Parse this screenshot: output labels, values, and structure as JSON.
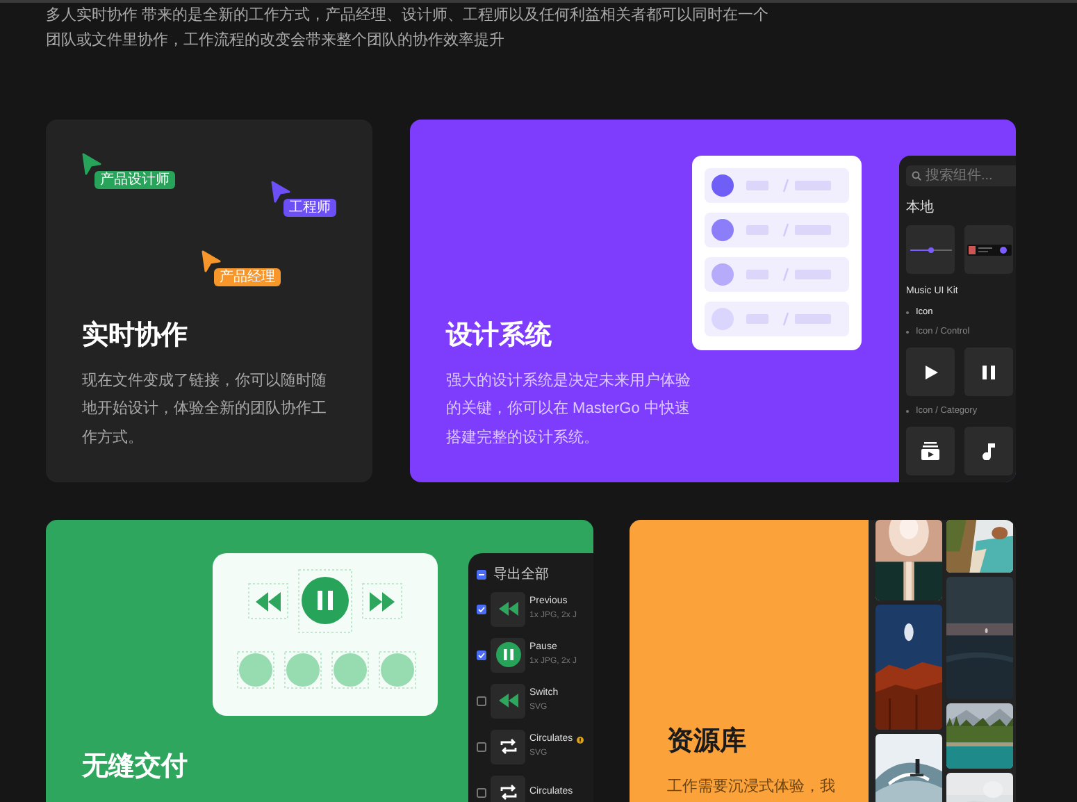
{
  "intro": {
    "text": "多人实时协作 带来的是全新的工作方式，产品经理、设计师、工程师以及任何利益相关者都可以同时在一个团队或文件里协作，工作流程的改变会带来整个团队的协作效率提升"
  },
  "collaboration": {
    "title": "实时协作",
    "body": "现在文件变成了链接，你可以随时随地开始设计，体验全新的团队协作工作方式。",
    "cursors": [
      {
        "label": "产品设计师",
        "color": "#27a35a"
      },
      {
        "label": "工程师",
        "color": "#6c4ff5"
      },
      {
        "label": "产品经理",
        "color": "#f7962b"
      }
    ]
  },
  "design_system": {
    "title": "设计系统",
    "body": "强大的设计系统是决定未来用户体验的关键，你可以在 MasterGo 中快速搭建完整的设计系统。",
    "panel": {
      "search": {
        "placeholder": "搜索组件..."
      },
      "section": "本地",
      "previews": [
        {
          "kind": "slider"
        },
        {
          "kind": "player"
        }
      ],
      "library": "Music UI Kit",
      "groups": [
        {
          "kind": "folder",
          "label": "Icon"
        },
        {
          "kind": "group",
          "label": "Icon / Control",
          "tiles": [
            {
              "kind": "play"
            },
            {
              "kind": "pause"
            }
          ]
        },
        {
          "kind": "group",
          "label": "Icon / Category",
          "tiles": [
            {
              "kind": "playlist"
            },
            {
              "kind": "note"
            }
          ]
        }
      ]
    }
  },
  "delivery": {
    "title": "无缝交付",
    "export": {
      "all": {
        "label": "导出全部",
        "indeterminate": true
      },
      "rows": [
        {
          "kind": "rewind",
          "name": "Previous",
          "formats": "1x JPG, 2x J",
          "checked": true,
          "warning": false
        },
        {
          "kind": "pause",
          "name": "Pause",
          "formats": "1x JPG, 2x J",
          "checked": true,
          "warning": false
        },
        {
          "kind": "rewind",
          "name": "Switch",
          "formats": "SVG",
          "checked": false,
          "warning": false
        },
        {
          "kind": "repeat",
          "name": "Circulates",
          "formats": "SVG",
          "checked": false,
          "warning": true
        },
        {
          "kind": "repeat",
          "name": "Circulates",
          "checked": false,
          "warning": false
        }
      ]
    }
  },
  "assets": {
    "title": "资源库",
    "body": "工作需要沉浸式体验，我"
  }
}
